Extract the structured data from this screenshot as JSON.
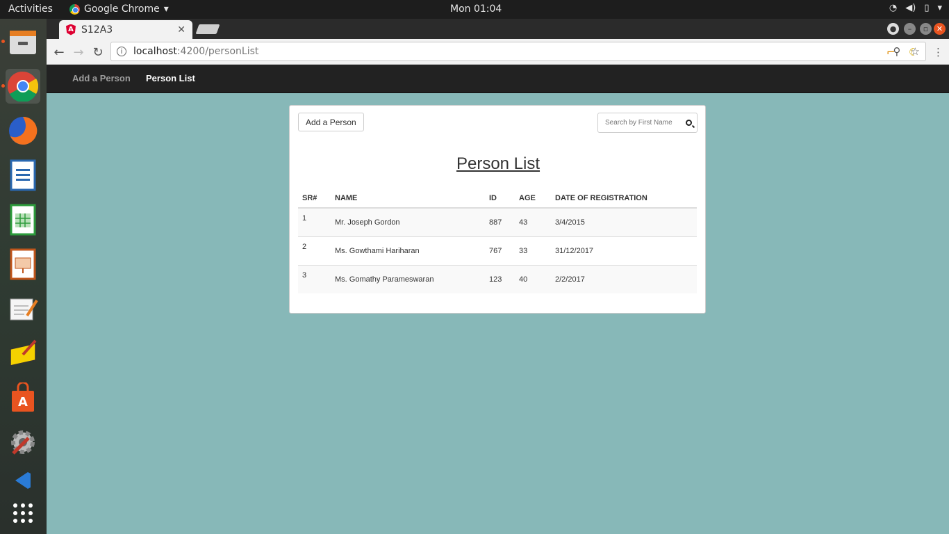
{
  "os": {
    "activities": "Activities",
    "app_menu": "Google Chrome",
    "clock": "Mon 01:04"
  },
  "browser": {
    "tab_title": "S12A3",
    "url_host": "localhost",
    "url_path": ":4200/personList"
  },
  "nav": {
    "add_person": "Add a Person",
    "person_list": "Person List"
  },
  "card": {
    "add_button": "Add a Person",
    "search_placeholder": "Search by First Name",
    "title": "Person List"
  },
  "table": {
    "headers": [
      "SR#",
      "NAME",
      "ID",
      "AGE",
      "DATE OF REGISTRATION"
    ],
    "rows": [
      {
        "sr": "1",
        "name": "Mr. Joseph Gordon",
        "id": "887",
        "age": "43",
        "date": "3/4/2015"
      },
      {
        "sr": "2",
        "name": "Ms. Gowthami Hariharan",
        "id": "767",
        "age": "33",
        "date": "31/12/2017"
      },
      {
        "sr": "3",
        "name": "Ms. Gomathy Parameswaran",
        "id": "123",
        "age": "40",
        "date": "2/2/2017"
      }
    ]
  },
  "colors": {
    "page_background": "#87b8b8",
    "navbar": "#222222",
    "angular_red": "#dd0031"
  }
}
